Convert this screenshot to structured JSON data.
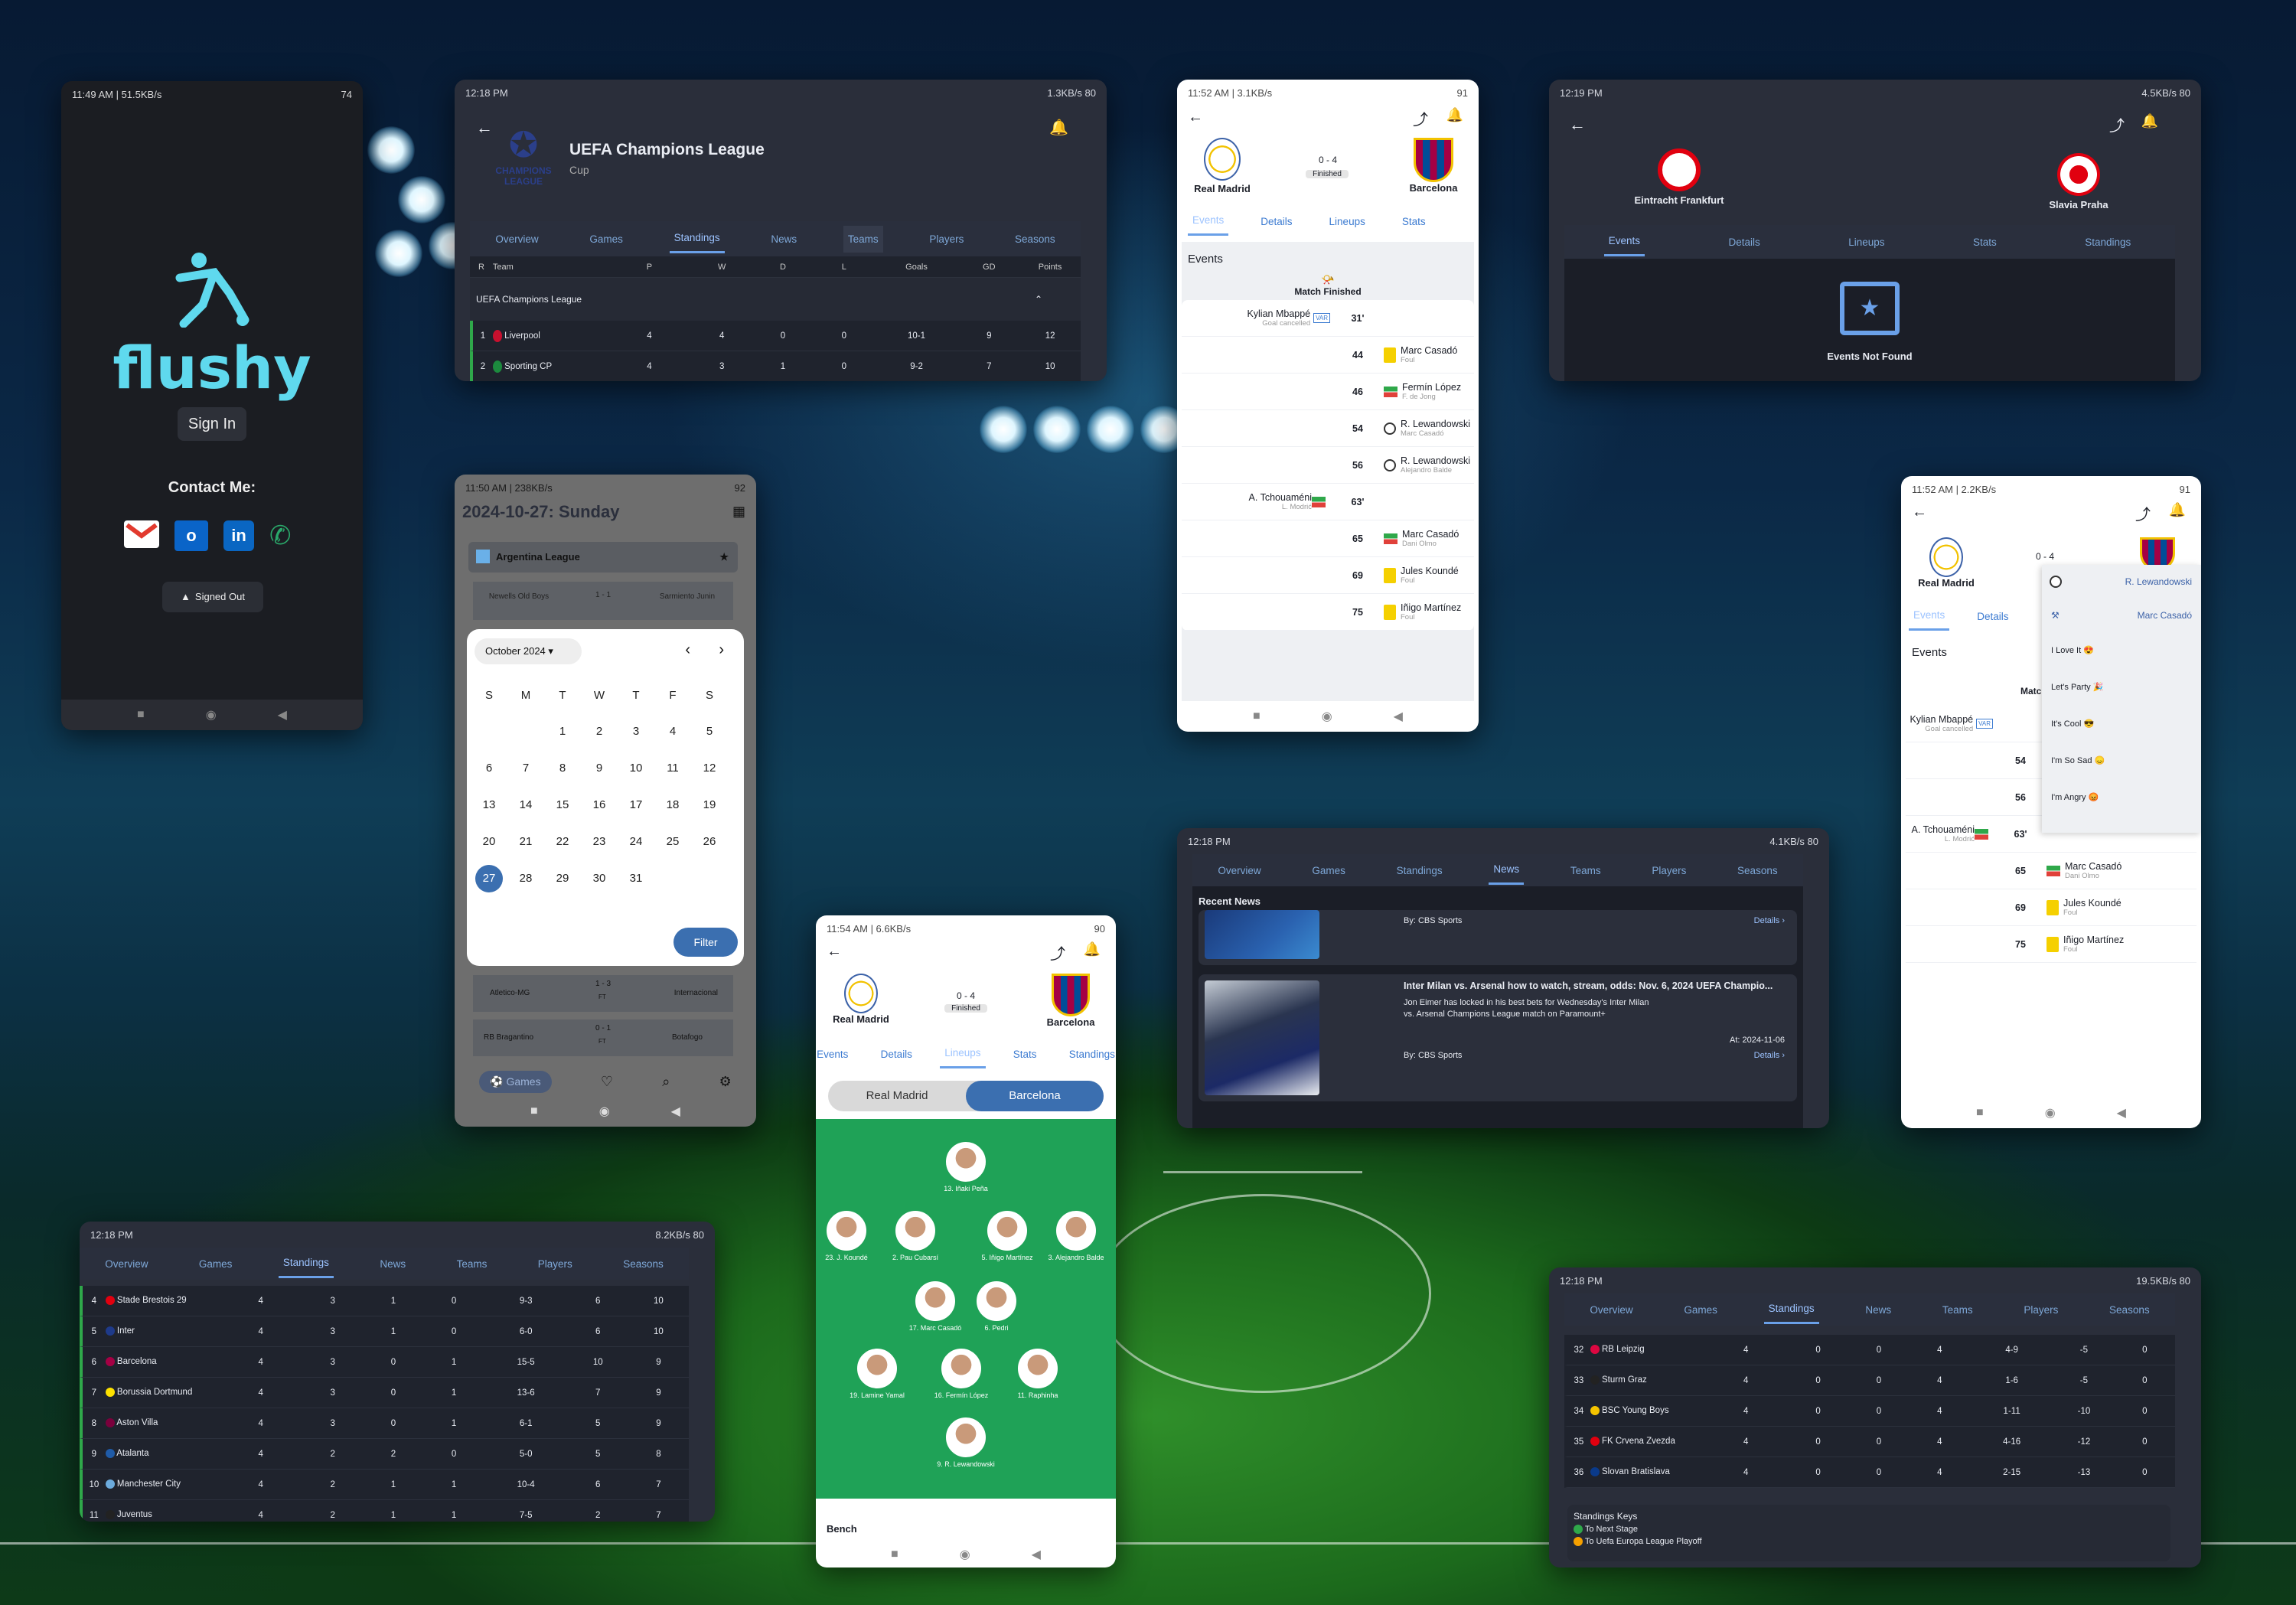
{
  "login": {
    "status": "11:49 AM | 51.5KB/s",
    "battery": "74",
    "brand": "flushy",
    "signin": "Sign In",
    "contact": "Contact Me:",
    "signed_out": "Signed Out"
  },
  "ucl": {
    "status_time": "12:18 PM",
    "status_right": "1.3KB/s 80",
    "title": "UEFA Champions League",
    "subtitle": "Cup",
    "logo_text": "CHAMPIONS LEAGUE",
    "tabs": [
      "Overview",
      "Games",
      "Standings",
      "News",
      "Teams",
      "Players",
      "Seasons"
    ],
    "headers": [
      "R",
      "Team",
      "P",
      "W",
      "D",
      "L",
      "Goals",
      "GD",
      "Points"
    ],
    "group": "UEFA Champions League",
    "rows": [
      [
        "1",
        "Liverpool",
        "4",
        "4",
        "0",
        "0",
        "10-1",
        "9",
        "12"
      ],
      [
        "2",
        "Sporting CP",
        "4",
        "3",
        "1",
        "0",
        "9-2",
        "7",
        "10"
      ]
    ]
  },
  "match1": {
    "status_time": "11:52 AM | 3.1KB/s",
    "battery": "91",
    "home": "Real Madrid",
    "away": "Barcelona",
    "score": "0 - 4",
    "state": "Finished",
    "tabs": [
      "Events",
      "Details",
      "Lineups",
      "Stats"
    ],
    "events_label": "Events",
    "finished": "Match Finished",
    "events": [
      {
        "side": "l",
        "name": "Kylian Mbappé",
        "sub": "Goal cancelled",
        "min": "31'",
        "icon": "var"
      },
      {
        "side": "r",
        "name": "Marc Casadó",
        "sub": "Foul",
        "min": "44",
        "icon": "yellow"
      },
      {
        "side": "r",
        "name": "Fermín López",
        "sub": "F. de Jong",
        "min": "46",
        "icon": "swap"
      },
      {
        "side": "r",
        "name": "R. Lewandowski",
        "sub": "Marc Casadó",
        "min": "54",
        "icon": "ball"
      },
      {
        "side": "r",
        "name": "R. Lewandowski",
        "sub": "Alejandro Balde",
        "min": "56",
        "icon": "ball"
      },
      {
        "side": "l",
        "name": "A. Tchouaméni",
        "sub": "L. Modrić",
        "min": "63'",
        "icon": "swap"
      },
      {
        "side": "r",
        "name": "Marc Casadó",
        "sub": "Dani Olmo",
        "min": "65",
        "icon": "swap"
      },
      {
        "side": "r",
        "name": "Jules Koundé",
        "sub": "Foul",
        "min": "69",
        "icon": "yellow"
      },
      {
        "side": "r",
        "name": "Iñigo Martínez",
        "sub": "Foul",
        "min": "75",
        "icon": "yellow"
      }
    ]
  },
  "eintracht": {
    "status_time": "12:19 PM",
    "status_right": "4.5KB/s 80",
    "home": "Eintracht Frankfurt",
    "away": "Slavia Praha",
    "tabs": [
      "Events",
      "Details",
      "Lineups",
      "Stats",
      "Standings"
    ],
    "empty": "Events Not Found"
  },
  "calendar": {
    "status": "11:50 AM | 238KB/s",
    "battery": "92",
    "date": "2024-10-27: Sunday",
    "league": "Argentina League",
    "month": "October 2024",
    "dow": [
      "S",
      "M",
      "T",
      "W",
      "T",
      "F",
      "S"
    ],
    "weeks": [
      [
        "",
        "",
        "1",
        "2",
        "3",
        "4",
        "5"
      ],
      [
        "6",
        "7",
        "8",
        "9",
        "10",
        "11",
        "12"
      ],
      [
        "13",
        "14",
        "15",
        "16",
        "17",
        "18",
        "19"
      ],
      [
        "20",
        "21",
        "22",
        "23",
        "24",
        "25",
        "26"
      ],
      [
        "27",
        "28",
        "29",
        "30",
        "31",
        "",
        ""
      ]
    ],
    "selected": "27",
    "filter": "Filter",
    "m1": {
      "home": "Newells Old Boys",
      "score": "1 - 1",
      "away": "Sarmiento Junin"
    },
    "m2": {
      "home": "Atletico-MG",
      "score": "1 - 3",
      "away": "Internacional"
    },
    "m3": {
      "home": "RB Bragantino",
      "score": "0 - 1",
      "away": "Botafogo"
    },
    "ft": "FT",
    "games": "Games"
  },
  "lineups": {
    "status": "11:54 AM | 6.6KB/s",
    "battery": "90",
    "home": "Real Madrid",
    "away": "Barcelona",
    "score": "0 - 4",
    "state": "Finished",
    "tabs": [
      "Events",
      "Details",
      "Lineups",
      "Stats",
      "Standings"
    ],
    "team_a": "Real Madrid",
    "team_b": "Barcelona",
    "bench": "Bench",
    "players": [
      "13. Iñaki Peña",
      "23. J. Koundé",
      "2. Pau Cubarsí",
      "5. Iñigo Martínez",
      "3. Alejandro Balde",
      "17. Marc Casadó",
      "6. Pedri",
      "19. Lamine Yamal",
      "16. Fermín López",
      "11. Raphinha",
      "9. R. Lewandowski"
    ]
  },
  "news": {
    "status_time": "12:18 PM",
    "status_right": "4.1KB/s 80",
    "tabs": [
      "Overview",
      "Games",
      "Standings",
      "News",
      "Teams",
      "Players",
      "Seasons"
    ],
    "recent": "Recent News",
    "a1": {
      "by": "By: CBS Sports",
      "details": "Details"
    },
    "a2": {
      "title": "Inter Milan vs. Arsenal how to watch, stream, odds: Nov. 6, 2024 UEFA Champio...",
      "body": "Jon Eimer has locked in his best bets for Wednesday's Inter Milan vs. Arsenal Champions League match on Paramount+",
      "at": "At: 2024-11-06",
      "by": "By: CBS Sports",
      "details": "Details"
    }
  },
  "react": {
    "status": "11:52 AM | 2.2KB/s",
    "battery": "91",
    "home": "Real Madrid",
    "score": "0 - 4",
    "tabs": [
      "Events",
      "Details"
    ],
    "events_label": "Events",
    "match": "Matc",
    "menu": [
      "R. Lewandowski",
      "Marc Casadó",
      "I Love It",
      "Let's Party",
      "It's Cool",
      "I'm So Sad",
      "I'm Angry"
    ],
    "events": [
      {
        "side": "l",
        "name": "Kylian Mbappé",
        "sub": "Goal cancelled",
        "min": "",
        "icon": "var"
      },
      {
        "side": "r",
        "name": "R. Lewandowski",
        "sub": "Marc Casadó",
        "min": "54",
        "icon": "ball"
      },
      {
        "side": "r",
        "name": "R. Lewandowski",
        "sub": "Alejandro Balde",
        "min": "56",
        "icon": "ball"
      },
      {
        "side": "l",
        "name": "A. Tchouaméni",
        "sub": "L. Modrić",
        "min": "63'",
        "icon": "swap"
      },
      {
        "side": "r",
        "name": "Marc Casadó",
        "sub": "Dani Olmo",
        "min": "65",
        "icon": "swap"
      },
      {
        "side": "r",
        "name": "Jules Koundé",
        "sub": "Foul",
        "min": "69",
        "icon": "yellow"
      },
      {
        "side": "r",
        "name": "Iñigo Martínez",
        "sub": "Foul",
        "min": "75",
        "icon": "yellow"
      }
    ]
  },
  "stand2": {
    "status_time": "12:18 PM",
    "status_right": "8.2KB/s 80",
    "tabs": [
      "Overview",
      "Games",
      "Standings",
      "News",
      "Teams",
      "Players",
      "Seasons"
    ],
    "rows": [
      [
        "4",
        "Stade Brestois 29",
        "4",
        "3",
        "1",
        "0",
        "9-3",
        "6",
        "10"
      ],
      [
        "5",
        "Inter",
        "4",
        "3",
        "1",
        "0",
        "6-0",
        "6",
        "10"
      ],
      [
        "6",
        "Barcelona",
        "4",
        "3",
        "0",
        "1",
        "15-5",
        "10",
        "9"
      ],
      [
        "7",
        "Borussia Dortmund",
        "4",
        "3",
        "0",
        "1",
        "13-6",
        "7",
        "9"
      ],
      [
        "8",
        "Aston Villa",
        "4",
        "3",
        "0",
        "1",
        "6-1",
        "5",
        "9"
      ],
      [
        "9",
        "Atalanta",
        "4",
        "2",
        "2",
        "0",
        "5-0",
        "5",
        "8"
      ],
      [
        "10",
        "Manchester City",
        "4",
        "2",
        "1",
        "1",
        "10-4",
        "6",
        "7"
      ],
      [
        "11",
        "Juventus",
        "4",
        "2",
        "1",
        "1",
        "7-5",
        "2",
        "7"
      ]
    ]
  },
  "stand3": {
    "status_time": "12:18 PM",
    "status_right": "19.5KB/s 80",
    "tabs": [
      "Overview",
      "Games",
      "Standings",
      "News",
      "Teams",
      "Players",
      "Seasons"
    ],
    "rows": [
      [
        "32",
        "RB Leipzig",
        "4",
        "0",
        "0",
        "4",
        "4-9",
        "-5",
        "0"
      ],
      [
        "33",
        "Sturm Graz",
        "4",
        "0",
        "0",
        "4",
        "1-6",
        "-5",
        "0"
      ],
      [
        "34",
        "BSC Young Boys",
        "4",
        "0",
        "0",
        "4",
        "1-11",
        "-10",
        "0"
      ],
      [
        "35",
        "FK Crvena Zvezda",
        "4",
        "0",
        "0",
        "4",
        "4-16",
        "-12",
        "0"
      ],
      [
        "36",
        "Slovan Bratislava",
        "4",
        "0",
        "0",
        "4",
        "2-15",
        "-13",
        "0"
      ]
    ],
    "keys_title": "Standings Keys",
    "keys": [
      "To Next Stage",
      "To Uefa Europa League Playoff"
    ]
  },
  "colors": {
    "accent": "#5fd9ee",
    "bg_dark": "#1b1e27",
    "tab": "#6aa0e8",
    "green_key": "#2fa84a",
    "orange_key": "#f5a000"
  }
}
